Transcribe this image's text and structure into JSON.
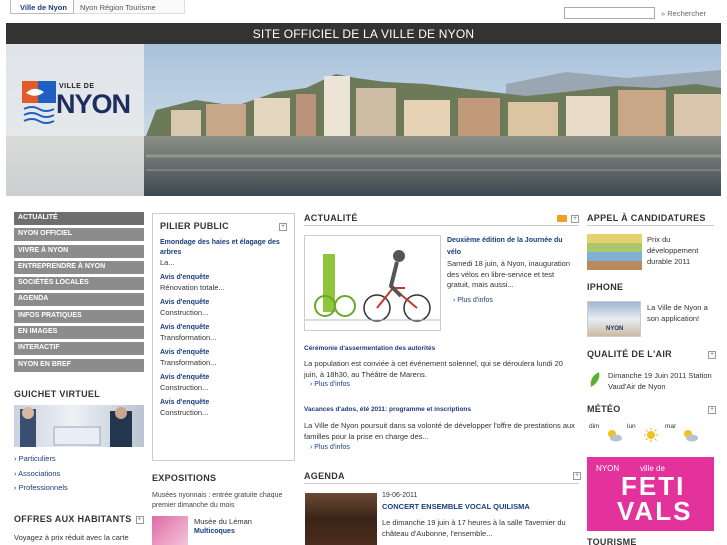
{
  "top": {
    "tab_active": "Ville de Nyon",
    "tab_other": "Nyon Région Tourisme",
    "search_button": "» Rechercher"
  },
  "header": {
    "strip_title": "SITE OFFICIEL DE LA VILLE DE NYON",
    "logo_small": "VILLE DE",
    "logo_big": "NYON"
  },
  "nav": {
    "items": [
      {
        "label": "ACTUALITÉ"
      },
      {
        "label": "NYON OFFICIEL"
      },
      {
        "label": "VIVRE À NYON"
      },
      {
        "label": "ENTREPRENDRE À NYON"
      },
      {
        "label": "SOCIÉTÉS LOCALES"
      },
      {
        "label": "AGENDA"
      },
      {
        "label": "INFOS PRATIQUES"
      },
      {
        "label": "EN IMAGES"
      },
      {
        "label": "INTERACTIF"
      },
      {
        "label": "NYON EN BREF"
      }
    ]
  },
  "guichet": {
    "title": "GUICHET VIRTUEL",
    "links": [
      {
        "label": "Particuliers"
      },
      {
        "label": "Associations"
      },
      {
        "label": "Professionnels"
      }
    ]
  },
  "offres": {
    "title": "OFFRES AUX HABITANTS",
    "text": "Voyagez à prix réduit avec la carte"
  },
  "pilier": {
    "title": "PILIER PUBLIC",
    "entries": [
      {
        "link": "Emondage des haies et élagage des arbres",
        "text": "La..."
      },
      {
        "link": "Avis d'enquête",
        "text": "Rénovation totale..."
      },
      {
        "link": "Avis d'enquête",
        "text": "Construction..."
      },
      {
        "link": "Avis d'enquête",
        "text": "Transformation..."
      },
      {
        "link": "Avis d'enquête",
        "text": "Transformation..."
      },
      {
        "link": "Avis d'enquête",
        "text": "Construction..."
      },
      {
        "link": "Avis d'enquête",
        "text": "Construction..."
      }
    ]
  },
  "expositions": {
    "title": "EXPOSITIONS",
    "text": "Musées nyonnais : entrée gratuite chaque premier dimanche du mois",
    "item1": "Musée du Léman",
    "item2": "Multicoques"
  },
  "actualite": {
    "title": "ACTUALITÉ",
    "item1": {
      "head": "Deuxième édition de la Journée du vélo",
      "body": "Samedi 18 juin, à Nyon, inauguration des vélos en libre-service et test gratuit, mais aussi...",
      "more": "Plus d'infos"
    },
    "item2": {
      "head": "Cérémonie d'assermentation des autorités",
      "body": "La population est conviée à cet événement solennel, qui se déroulera lundi 20 juin, à 18h30, au Théâtre de Marens.",
      "more": "Plus d'infos"
    },
    "item3": {
      "head": "Vacances d'ados, été 2011: programme et inscriptions",
      "body": "La Ville de Nyon poursuit dans sa volonté de développer l'offre de prestations aux familles pour la prise en charge des...",
      "more": "Plus d'infos"
    }
  },
  "agenda": {
    "title": "AGENDA",
    "date": "19-06-2011",
    "head": "CONCERT ENSEMBLE VOCAL QUILISMA",
    "body": "Le dimanche 19 juin à 17 heures à la salle Tavernier du château d'Aubonne, l'ensemble..."
  },
  "right": {
    "appel_title": "APPEL À CANDIDATURES",
    "appel_text": "Prix du développement durable 2011",
    "iphone_title": "IPHONE",
    "iphone_text": "La Ville de Nyon a son application!",
    "iphone_img_label": "NYON",
    "air_title": "QUALITÉ DE L'AIR",
    "air_text": "Dimanche 19 Juin 2011 Station Vaud'Air de Nyon",
    "meteo_title": "MÉTÉO",
    "meteo_days": [
      "dim",
      "lun",
      "mar"
    ],
    "festival_nyon": "NYON",
    "festival_ville": "ville de",
    "festival_big1": "FETI",
    "festival_big2": "VALS",
    "tourisme_title": "TOURISME"
  },
  "colors": {
    "nav_bg": "#8c8c8c",
    "header_strip": "#333333",
    "link": "#1a3d7c",
    "festival_bg": "#e3329c"
  }
}
